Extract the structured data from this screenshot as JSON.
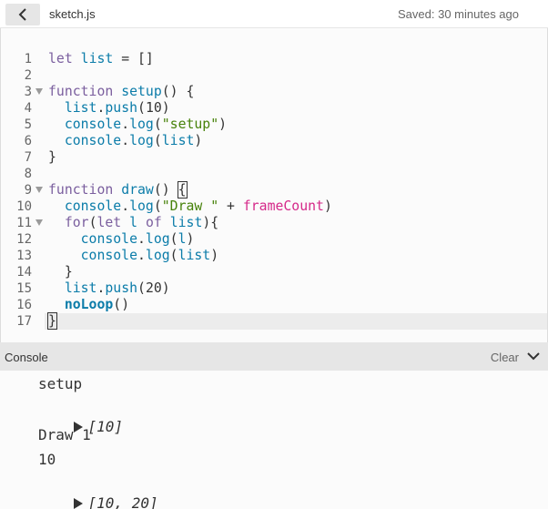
{
  "header": {
    "collapse_icon": "chevron-left-icon",
    "filename": "sketch.js",
    "saved_status": "Saved: 30 minutes ago"
  },
  "editor": {
    "line_numbers": [
      "1",
      "2",
      "3",
      "4",
      "5",
      "6",
      "7",
      "8",
      "9",
      "10",
      "11",
      "12",
      "13",
      "14",
      "15",
      "16",
      "17"
    ],
    "foldable_lines": [
      3,
      9,
      11
    ],
    "active_line": 17,
    "lines": [
      "let list = []",
      "",
      "function setup() {",
      "  list.push(10)",
      "  console.log(\"setup\")",
      "  console.log(list)",
      "}",
      "",
      "function draw() {",
      "  console.log(\"Draw \" + frameCount)",
      "  for(let l of list){",
      "    console.log(l)",
      "    console.log(list)",
      "  }",
      "  list.push(20)",
      "  noLoop()",
      "}"
    ]
  },
  "console": {
    "title": "Console",
    "clear_label": "Clear",
    "collapse_icon": "chevron-down-icon",
    "messages": [
      {
        "type": "text",
        "text": "setup"
      },
      {
        "type": "array",
        "text": "[10]"
      },
      {
        "type": "text",
        "text": "Draw 1"
      },
      {
        "type": "text",
        "text": "10"
      },
      {
        "type": "array",
        "text": "[10, 20]"
      }
    ]
  },
  "colors": {
    "keyword": "#7a5e9e",
    "variable": "#0b7ca9",
    "string": "#47820a",
    "global": "#d52889",
    "active_line_bg": "#ececec",
    "console_header_bg": "#e6e6e6"
  }
}
